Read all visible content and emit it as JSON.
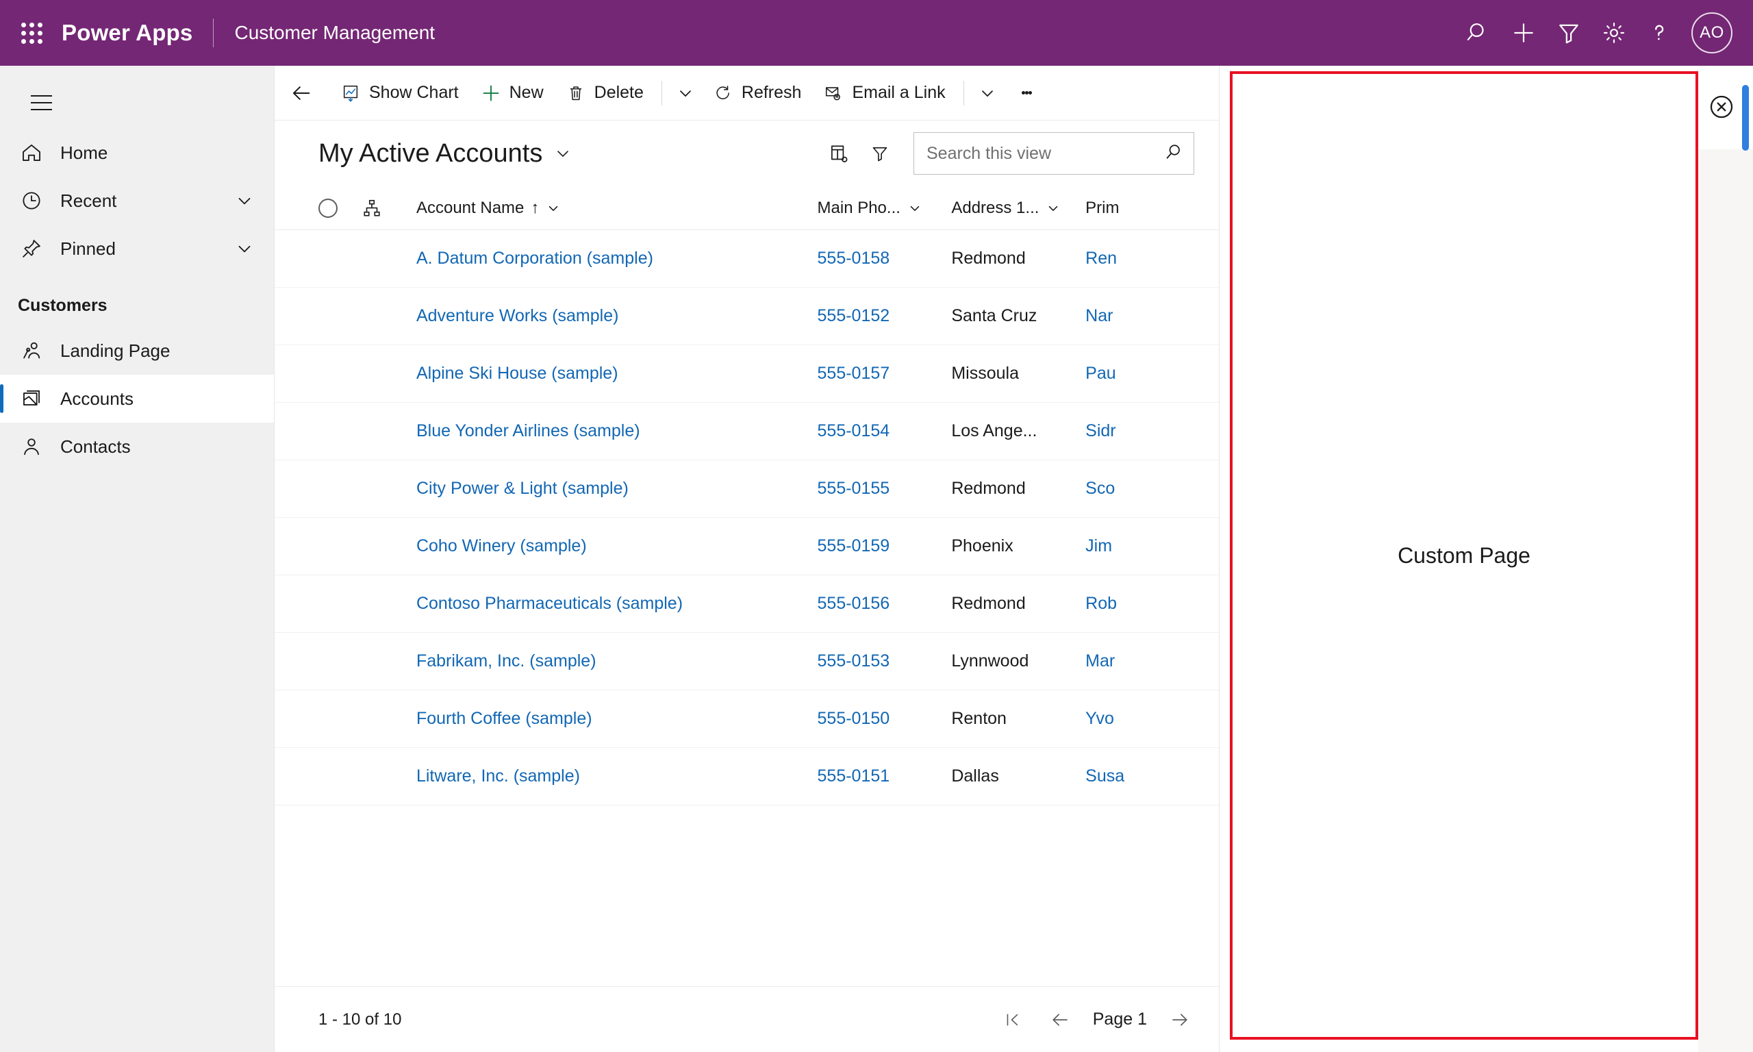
{
  "header": {
    "waffle_icon": "app-launcher-icon",
    "brand": "Power Apps",
    "app_name": "Customer Management",
    "icons": [
      {
        "name": "search-icon",
        "label": "Search"
      },
      {
        "name": "plus-icon",
        "label": "New"
      },
      {
        "name": "filter-icon",
        "label": "Filter"
      },
      {
        "name": "gear-icon",
        "label": "Settings"
      },
      {
        "name": "help-icon",
        "label": "Help"
      }
    ],
    "avatar_initials": "AO",
    "background_color": "#742774"
  },
  "sidebar": {
    "hamburger_icon": "hamburger-icon",
    "items": [
      {
        "label": "Home",
        "icon": "home-icon",
        "chevron": false,
        "selected": false
      },
      {
        "label": "Recent",
        "icon": "clock-icon",
        "chevron": true,
        "selected": false
      },
      {
        "label": "Pinned",
        "icon": "pin-icon",
        "chevron": true,
        "selected": false
      }
    ],
    "group_title": "Customers",
    "group_items": [
      {
        "label": "Landing Page",
        "icon": "people-icon",
        "selected": false
      },
      {
        "label": "Accounts",
        "icon": "accounts-icon",
        "selected": true
      },
      {
        "label": "Contacts",
        "icon": "contact-icon",
        "selected": false
      }
    ],
    "background_color": "#f0f0f0",
    "accent_color": "#0f6cbd"
  },
  "commandbar": {
    "back_icon": "back-arrow-icon",
    "buttons": [
      {
        "label": "Show Chart",
        "icon": "chart-icon"
      },
      {
        "label": "New",
        "icon": "plus-icon"
      },
      {
        "label": "Delete",
        "icon": "trash-icon"
      }
    ],
    "chevron1": "chevron-down-icon",
    "buttons2": [
      {
        "label": "Refresh",
        "icon": "refresh-icon"
      },
      {
        "label": "Email a Link",
        "icon": "email-link-icon"
      }
    ],
    "chevron2": "chevron-down-icon",
    "overflow": "more-vertical-icon"
  },
  "view": {
    "title": "My Active Accounts",
    "title_chevron": "chevron-down-icon",
    "edit_columns_icon": "edit-columns-icon",
    "filter_icon": "filter-icon",
    "search_placeholder": "Search this view",
    "search_value": "",
    "search_icon": "search-icon"
  },
  "grid": {
    "select_all_icon": "select-all-circle-icon",
    "hierarchy_icon": "hierarchy-icon",
    "columns": [
      {
        "label": "Account Name",
        "sort": "↑",
        "chevron": "chevron-down-icon"
      },
      {
        "label": "Main Pho...",
        "chevron": "chevron-down-icon"
      },
      {
        "label": "Address 1...",
        "chevron": "chevron-down-icon"
      },
      {
        "label": "Prim",
        "chevron": ""
      }
    ],
    "rows": [
      {
        "name": "A. Datum Corporation (sample)",
        "phone": "555-0158",
        "city": "Redmond",
        "primary": "Ren"
      },
      {
        "name": "Adventure Works (sample)",
        "phone": "555-0152",
        "city": "Santa Cruz",
        "primary": "Nar"
      },
      {
        "name": "Alpine Ski House (sample)",
        "phone": "555-0157",
        "city": "Missoula",
        "primary": "Pau"
      },
      {
        "name": "Blue Yonder Airlines (sample)",
        "phone": "555-0154",
        "city": "Los Ange...",
        "primary": "Sidr"
      },
      {
        "name": "City Power & Light (sample)",
        "phone": "555-0155",
        "city": "Redmond",
        "primary": "Sco"
      },
      {
        "name": "Coho Winery (sample)",
        "phone": "555-0159",
        "city": "Phoenix",
        "primary": "Jim"
      },
      {
        "name": "Contoso Pharmaceuticals (sample)",
        "phone": "555-0156",
        "city": "Redmond",
        "primary": "Rob"
      },
      {
        "name": "Fabrikam, Inc. (sample)",
        "phone": "555-0153",
        "city": "Lynnwood",
        "primary": "Mar"
      },
      {
        "name": "Fourth Coffee (sample)",
        "phone": "555-0150",
        "city": "Renton",
        "primary": "Yvo"
      },
      {
        "name": "Litware, Inc. (sample)",
        "phone": "555-0151",
        "city": "Dallas",
        "primary": "Susa"
      }
    ],
    "link_color": "#1267b4"
  },
  "footer": {
    "record_count": "1 - 10 of 10",
    "first_page_icon": "first-page-icon",
    "prev_page_icon": "previous-page-icon",
    "page_label": "Page 1",
    "next_page_icon": "next-page-icon"
  },
  "rightpanel": {
    "label": "Custom Page",
    "border_color": "#e81123",
    "close_icon": "close-circle-icon",
    "scrollbar_color": "#2f7ee0"
  }
}
